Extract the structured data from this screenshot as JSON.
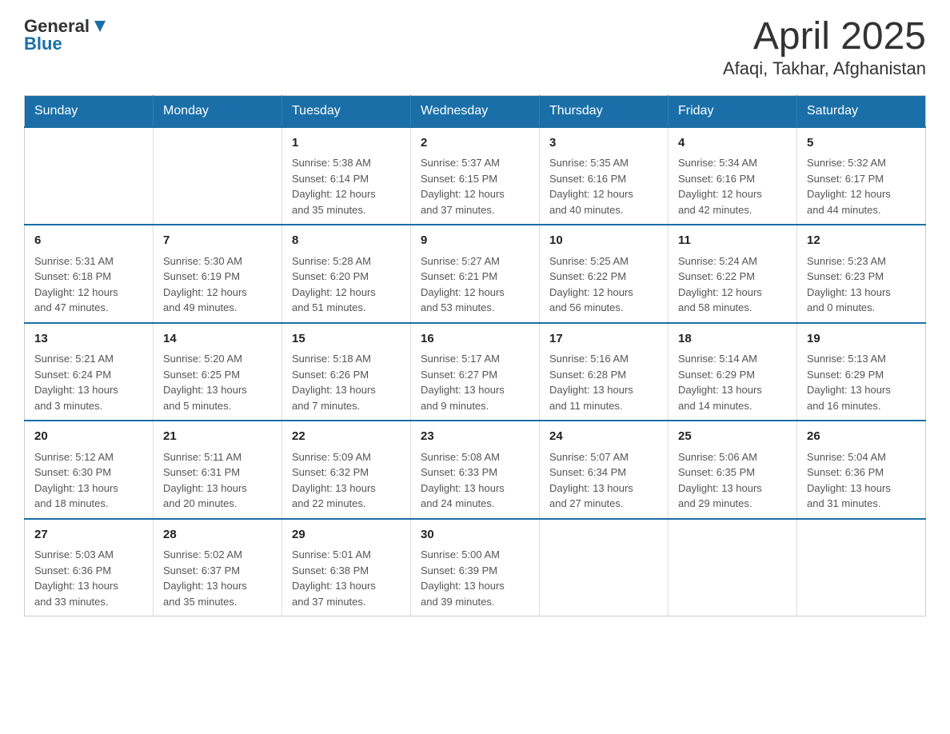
{
  "header": {
    "logo": {
      "general": "General",
      "blue": "Blue"
    },
    "title": "April 2025",
    "subtitle": "Afaqi, Takhar, Afghanistan"
  },
  "weekdays": [
    "Sunday",
    "Monday",
    "Tuesday",
    "Wednesday",
    "Thursday",
    "Friday",
    "Saturday"
  ],
  "weeks": [
    [
      {
        "day": "",
        "info": ""
      },
      {
        "day": "",
        "info": ""
      },
      {
        "day": "1",
        "info": "Sunrise: 5:38 AM\nSunset: 6:14 PM\nDaylight: 12 hours\nand 35 minutes."
      },
      {
        "day": "2",
        "info": "Sunrise: 5:37 AM\nSunset: 6:15 PM\nDaylight: 12 hours\nand 37 minutes."
      },
      {
        "day": "3",
        "info": "Sunrise: 5:35 AM\nSunset: 6:16 PM\nDaylight: 12 hours\nand 40 minutes."
      },
      {
        "day": "4",
        "info": "Sunrise: 5:34 AM\nSunset: 6:16 PM\nDaylight: 12 hours\nand 42 minutes."
      },
      {
        "day": "5",
        "info": "Sunrise: 5:32 AM\nSunset: 6:17 PM\nDaylight: 12 hours\nand 44 minutes."
      }
    ],
    [
      {
        "day": "6",
        "info": "Sunrise: 5:31 AM\nSunset: 6:18 PM\nDaylight: 12 hours\nand 47 minutes."
      },
      {
        "day": "7",
        "info": "Sunrise: 5:30 AM\nSunset: 6:19 PM\nDaylight: 12 hours\nand 49 minutes."
      },
      {
        "day": "8",
        "info": "Sunrise: 5:28 AM\nSunset: 6:20 PM\nDaylight: 12 hours\nand 51 minutes."
      },
      {
        "day": "9",
        "info": "Sunrise: 5:27 AM\nSunset: 6:21 PM\nDaylight: 12 hours\nand 53 minutes."
      },
      {
        "day": "10",
        "info": "Sunrise: 5:25 AM\nSunset: 6:22 PM\nDaylight: 12 hours\nand 56 minutes."
      },
      {
        "day": "11",
        "info": "Sunrise: 5:24 AM\nSunset: 6:22 PM\nDaylight: 12 hours\nand 58 minutes."
      },
      {
        "day": "12",
        "info": "Sunrise: 5:23 AM\nSunset: 6:23 PM\nDaylight: 13 hours\nand 0 minutes."
      }
    ],
    [
      {
        "day": "13",
        "info": "Sunrise: 5:21 AM\nSunset: 6:24 PM\nDaylight: 13 hours\nand 3 minutes."
      },
      {
        "day": "14",
        "info": "Sunrise: 5:20 AM\nSunset: 6:25 PM\nDaylight: 13 hours\nand 5 minutes."
      },
      {
        "day": "15",
        "info": "Sunrise: 5:18 AM\nSunset: 6:26 PM\nDaylight: 13 hours\nand 7 minutes."
      },
      {
        "day": "16",
        "info": "Sunrise: 5:17 AM\nSunset: 6:27 PM\nDaylight: 13 hours\nand 9 minutes."
      },
      {
        "day": "17",
        "info": "Sunrise: 5:16 AM\nSunset: 6:28 PM\nDaylight: 13 hours\nand 11 minutes."
      },
      {
        "day": "18",
        "info": "Sunrise: 5:14 AM\nSunset: 6:29 PM\nDaylight: 13 hours\nand 14 minutes."
      },
      {
        "day": "19",
        "info": "Sunrise: 5:13 AM\nSunset: 6:29 PM\nDaylight: 13 hours\nand 16 minutes."
      }
    ],
    [
      {
        "day": "20",
        "info": "Sunrise: 5:12 AM\nSunset: 6:30 PM\nDaylight: 13 hours\nand 18 minutes."
      },
      {
        "day": "21",
        "info": "Sunrise: 5:11 AM\nSunset: 6:31 PM\nDaylight: 13 hours\nand 20 minutes."
      },
      {
        "day": "22",
        "info": "Sunrise: 5:09 AM\nSunset: 6:32 PM\nDaylight: 13 hours\nand 22 minutes."
      },
      {
        "day": "23",
        "info": "Sunrise: 5:08 AM\nSunset: 6:33 PM\nDaylight: 13 hours\nand 24 minutes."
      },
      {
        "day": "24",
        "info": "Sunrise: 5:07 AM\nSunset: 6:34 PM\nDaylight: 13 hours\nand 27 minutes."
      },
      {
        "day": "25",
        "info": "Sunrise: 5:06 AM\nSunset: 6:35 PM\nDaylight: 13 hours\nand 29 minutes."
      },
      {
        "day": "26",
        "info": "Sunrise: 5:04 AM\nSunset: 6:36 PM\nDaylight: 13 hours\nand 31 minutes."
      }
    ],
    [
      {
        "day": "27",
        "info": "Sunrise: 5:03 AM\nSunset: 6:36 PM\nDaylight: 13 hours\nand 33 minutes."
      },
      {
        "day": "28",
        "info": "Sunrise: 5:02 AM\nSunset: 6:37 PM\nDaylight: 13 hours\nand 35 minutes."
      },
      {
        "day": "29",
        "info": "Sunrise: 5:01 AM\nSunset: 6:38 PM\nDaylight: 13 hours\nand 37 minutes."
      },
      {
        "day": "30",
        "info": "Sunrise: 5:00 AM\nSunset: 6:39 PM\nDaylight: 13 hours\nand 39 minutes."
      },
      {
        "day": "",
        "info": ""
      },
      {
        "day": "",
        "info": ""
      },
      {
        "day": "",
        "info": ""
      }
    ]
  ]
}
